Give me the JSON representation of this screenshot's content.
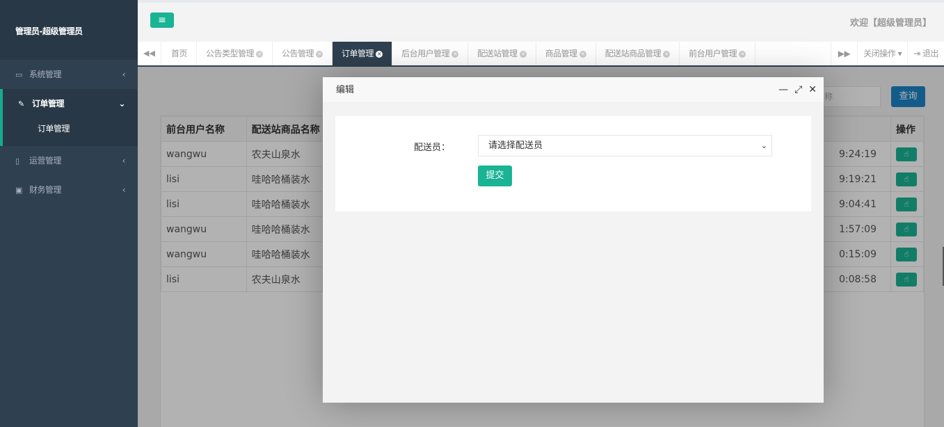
{
  "sidebar": {
    "title": "管理员-超级管理员",
    "items": [
      {
        "icon": "monitor-icon",
        "label": "系统管理",
        "arrow": "‹"
      },
      {
        "icon": "edit-icon",
        "label": "订单管理",
        "arrow": "⌄"
      },
      {
        "icon": "map-icon",
        "label": "运营管理",
        "arrow": "‹"
      },
      {
        "icon": "money-icon",
        "label": "财务管理",
        "arrow": "‹"
      }
    ],
    "sub_item": "订单管理"
  },
  "topbar": {
    "menu_icon": "hamburger-icon",
    "welcome": "欢迎【超级管理员】"
  },
  "tabs": {
    "items": [
      {
        "label": "首页",
        "closable": false
      },
      {
        "label": "公告类型管理",
        "closable": true
      },
      {
        "label": "公告管理",
        "closable": true
      },
      {
        "label": "订单管理",
        "closable": true,
        "active": true
      },
      {
        "label": "后台用户管理",
        "closable": true
      },
      {
        "label": "配送站管理",
        "closable": true
      },
      {
        "label": "商品管理",
        "closable": true
      },
      {
        "label": "配送站商品管理",
        "closable": true
      },
      {
        "label": "前台用户管理",
        "closable": true
      }
    ],
    "close_ops": "关闭操作",
    "logout": "退出"
  },
  "search": {
    "placeholder_visible": "称",
    "button": "查询"
  },
  "table": {
    "headers": [
      "前台用户名称",
      "配送站商品名称",
      "操作"
    ],
    "rows": [
      {
        "user": "wangwu",
        "product": "农夫山泉水",
        "time": "9:24:19"
      },
      {
        "user": "lisi",
        "product": "哇哈哈桶装水",
        "time": "9:19:21"
      },
      {
        "user": "lisi",
        "product": "哇哈哈桶装水",
        "time": "9:04:41"
      },
      {
        "user": "wangwu",
        "product": "哇哈哈桶装水",
        "time": "1:57:09"
      },
      {
        "user": "wangwu",
        "product": "哇哈哈桶装水",
        "time": "0:15:09"
      },
      {
        "user": "lisi",
        "product": "农夫山泉水",
        "time": "0:08:58"
      }
    ]
  },
  "modal": {
    "title": "编辑",
    "controls": [
      "minimize-icon",
      "maximize-icon",
      "close-icon"
    ],
    "form": {
      "label": "配送员：",
      "select_value": "请选择配送员",
      "submit": "提交"
    }
  }
}
